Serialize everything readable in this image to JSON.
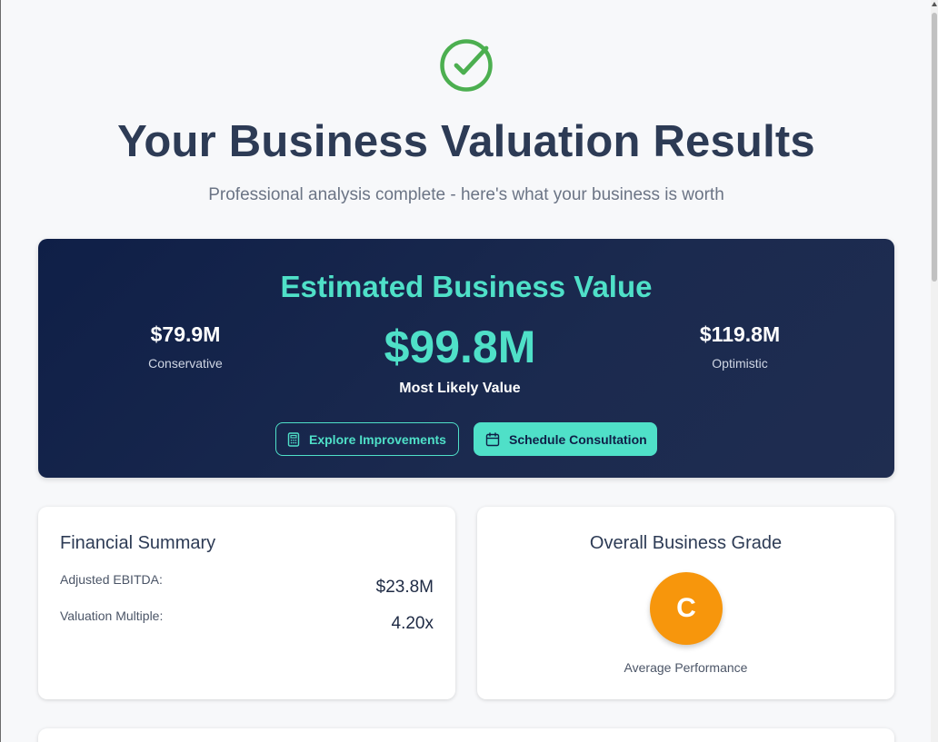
{
  "header": {
    "icon": "check-circle-icon",
    "title": "Your Business Valuation Results",
    "subtitle": "Professional analysis complete - here's what your business is worth"
  },
  "valuation": {
    "title": "Estimated Business Value",
    "conservative": {
      "amount": "$79.9M",
      "label": "Conservative"
    },
    "likely": {
      "amount": "$99.8M",
      "label": "Most Likely Value"
    },
    "optimistic": {
      "amount": "$119.8M",
      "label": "Optimistic"
    },
    "buttons": {
      "explore": {
        "label": "Explore Improvements",
        "icon": "calculator-icon"
      },
      "schedule": {
        "label": "Schedule Consultation",
        "icon": "calendar-icon"
      }
    }
  },
  "financial_summary": {
    "title": "Financial Summary",
    "rows": [
      {
        "label": "Adjusted EBITDA:",
        "value": "$23.8M"
      },
      {
        "label": "Valuation Multiple:",
        "value": "4.20x"
      }
    ]
  },
  "grade": {
    "title": "Overall Business Grade",
    "letter": "C",
    "label": "Average Performance"
  },
  "colors": {
    "accent": "#4fe0c8",
    "hero_bg": "#0f1f47",
    "grade": "#f7960c",
    "success": "#4caf50"
  }
}
